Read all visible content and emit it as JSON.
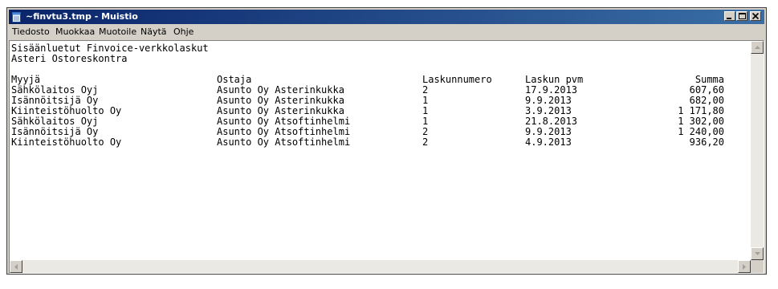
{
  "window": {
    "title": "~finvtu3.tmp - Muistio",
    "icon": "notepad-icon"
  },
  "menu": [
    "Tiedosto",
    "Muokkaa",
    "Muotoile",
    "Näytä",
    "Ohje"
  ],
  "document": {
    "line1": "Sisäänluetut Finvoice-verkkolaskut",
    "line2": "Asteri Ostoreskontra",
    "headers": [
      "Myyjä",
      "Ostaja",
      "Laskunnumero",
      "Laskun pvm",
      "Summa"
    ],
    "rows": [
      [
        "Sähkölaitos Oyj",
        "Asunto Oy Asterinkukka",
        "2",
        "17.9.2013",
        "607,60"
      ],
      [
        "Isännöitsijä Oy",
        "Asunto Oy Asterinkukka",
        "1",
        "9.9.2013",
        "682,00"
      ],
      [
        "Kiinteistöhuolto Oy",
        "Asunto Oy Asterinkukka",
        "1",
        "3.9.2013",
        "1 171,80"
      ],
      [
        "Sähkölaitos Oyj",
        "Asunto Oy Atsoftinhelmi",
        "1",
        "21.8.2013",
        "1 302,00"
      ],
      [
        "Isännöitsijä Oy",
        "Asunto Oy Atsoftinhelmi",
        "2",
        "9.9.2013",
        "1 240,00"
      ],
      [
        "Kiinteistöhuolto Oy",
        "Asunto Oy Atsoftinhelmi",
        "2",
        "4.9.2013",
        "936,20"
      ]
    ]
  },
  "colors": {
    "titlebar_start": "#0a246a",
    "titlebar_end": "#3a6ea5",
    "chrome": "#d4d0c8"
  }
}
